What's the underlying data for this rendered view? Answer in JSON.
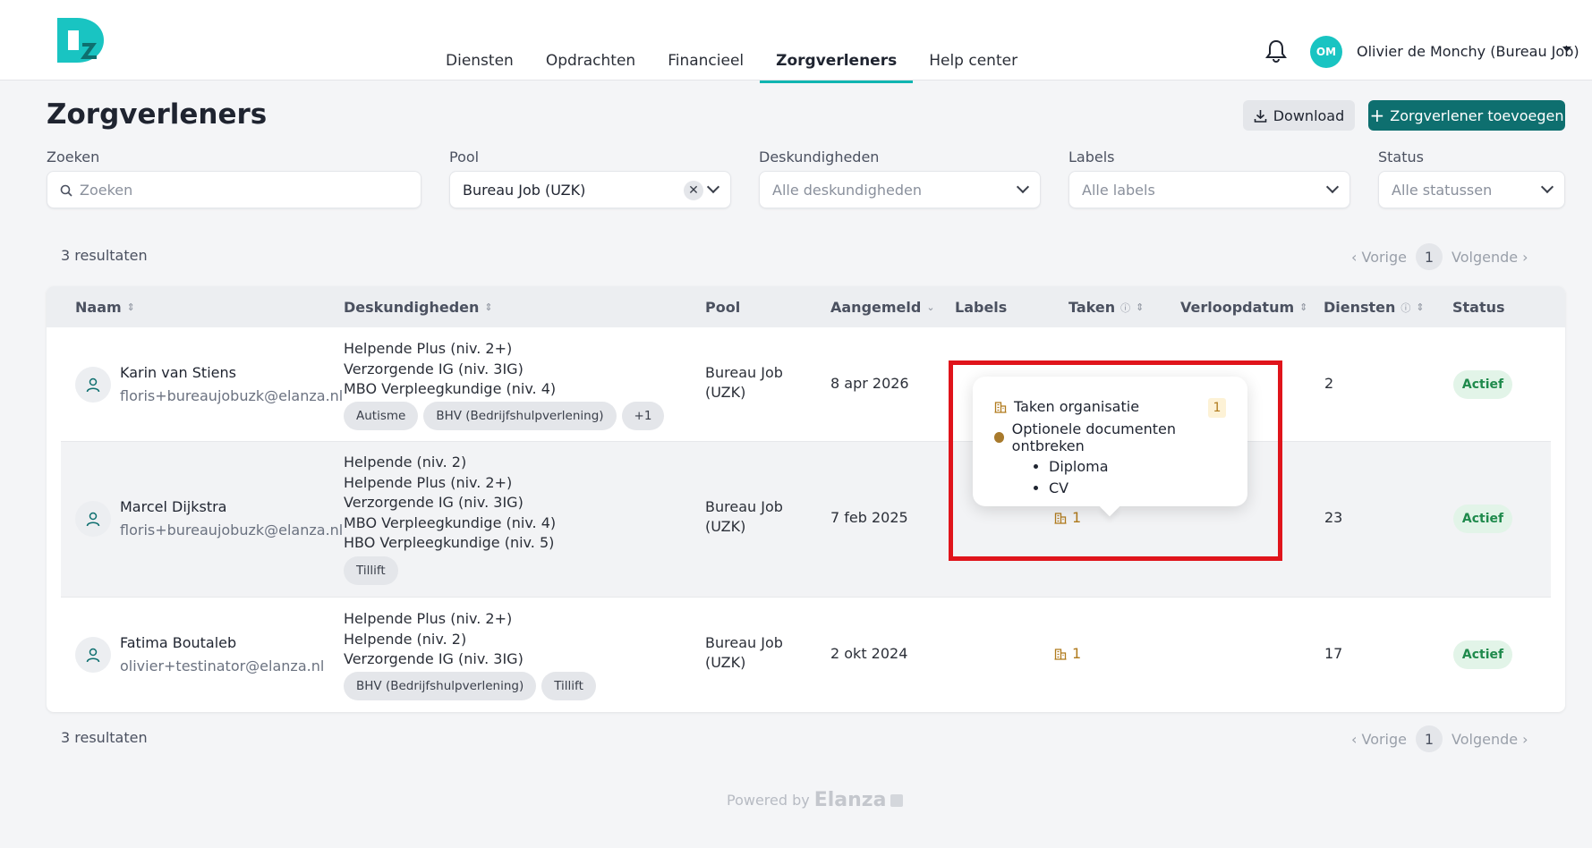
{
  "nav": {
    "tabs": [
      {
        "label": "Diensten"
      },
      {
        "label": "Opdrachten"
      },
      {
        "label": "Financieel"
      },
      {
        "label": "Zorgverleners"
      },
      {
        "label": "Help center"
      }
    ],
    "active_tab": "Zorgverleners"
  },
  "user": {
    "initials": "OM",
    "name": "Olivier de Monchy (Bureau Job)"
  },
  "page": {
    "title": "Zorgverleners",
    "download_label": "Download",
    "add_label": "Zorgverlener toevoegen"
  },
  "filters": {
    "search": {
      "label": "Zoeken",
      "placeholder": "Zoeken"
    },
    "pool": {
      "label": "Pool",
      "value": "Bureau Job (UZK)"
    },
    "skills": {
      "label": "Deskundigheden",
      "value": "Alle deskundigheden"
    },
    "labels": {
      "label": "Labels",
      "value": "Alle labels"
    },
    "status": {
      "label": "Status",
      "value": "Alle statussen"
    }
  },
  "results": {
    "top": "3 resultaten",
    "bottom": "3 resultaten",
    "prev": "Vorige",
    "next": "Volgende",
    "page": "1"
  },
  "table": {
    "headers": {
      "name": "Naam",
      "skills": "Deskundigheden",
      "pool": "Pool",
      "registered": "Aangemeld",
      "labels": "Labels",
      "tasks": "Taken",
      "expiry": "Verloopdatum",
      "shifts": "Diensten",
      "status": "Status"
    },
    "rows": [
      {
        "name": "Karin van Stiens",
        "email": "floris+bureaujobuzk@elanza.nl",
        "skills": [
          "Helpende Plus (niv. 2+)",
          "Verzorgende IG (niv. 3IG)",
          "MBO Verpleegkundige (niv. 4)"
        ],
        "tags": [
          "Autisme",
          "BHV (Bedrijfshulpverlening)",
          "+1"
        ],
        "pool_line1": "Bureau Job",
        "pool_line2": "(UZK)",
        "registered": "8 apr 2026",
        "tasks": "",
        "shifts": "2",
        "status": "Actief"
      },
      {
        "name": "Marcel Dijkstra",
        "email": "floris+bureaujobuzk@elanza.nl",
        "skills": [
          "Helpende (niv. 2)",
          "Helpende Plus (niv. 2+)",
          "Verzorgende IG (niv. 3IG)",
          "MBO Verpleegkundige (niv. 4)",
          "HBO Verpleegkundige (niv. 5)"
        ],
        "tags": [
          "Tillift"
        ],
        "pool_line1": "Bureau Job",
        "pool_line2": "(UZK)",
        "registered": "7 feb 2025",
        "tasks": "1",
        "shifts": "23",
        "status": "Actief"
      },
      {
        "name": "Fatima Boutaleb",
        "email": "olivier+testinator@elanza.nl",
        "skills": [
          "Helpende Plus (niv. 2+)",
          "Helpende (niv. 2)",
          "Verzorgende IG (niv. 3IG)"
        ],
        "tags": [
          "BHV (Bedrijfshulpverlening)",
          "Tillift"
        ],
        "pool_line1": "Bureau Job",
        "pool_line2": "(UZK)",
        "registered": "2 okt 2024",
        "tasks": "1",
        "shifts": "17",
        "status": "Actief"
      }
    ]
  },
  "tooltip": {
    "title": "Taken organisatie",
    "count": "1",
    "item": "Optionele documenten ontbreken",
    "subitems": [
      "Diploma",
      "CV"
    ]
  },
  "footer": {
    "powered": "Powered by",
    "brand": "Elanza"
  },
  "colors": {
    "accent": "#0fb5b1",
    "primary_button": "#0e6f6f",
    "status_active": "#1f8a4c",
    "task": "#b07a1c",
    "highlight_box": "#e0141b"
  }
}
